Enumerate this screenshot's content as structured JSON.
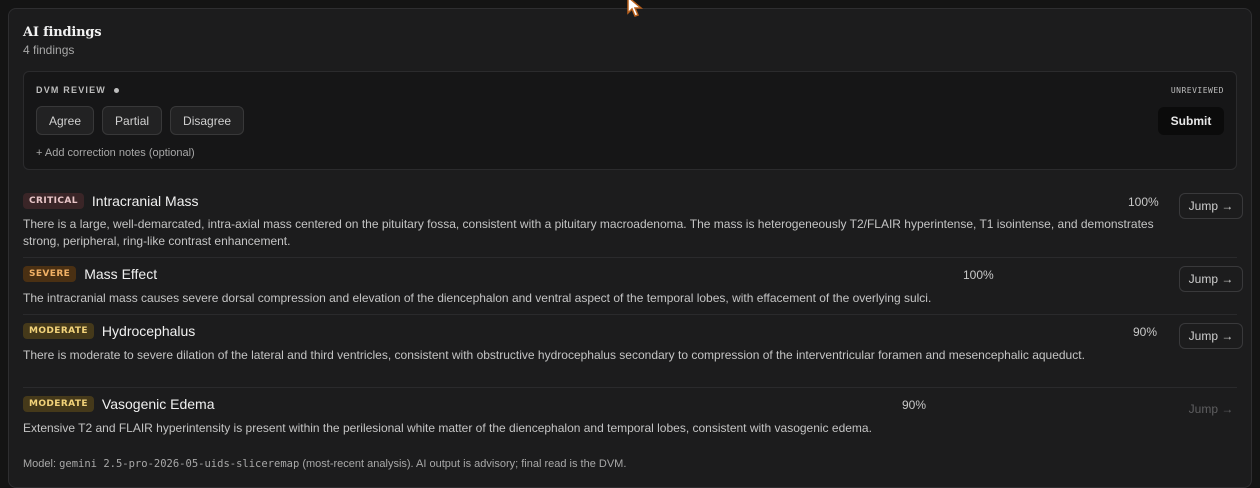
{
  "panel": {
    "title": "AI findings",
    "count_text": "4 findings"
  },
  "review": {
    "label": "DVM REVIEW",
    "status": "UNREVIEWED",
    "buttons": [
      "Agree",
      "Partial",
      "Disagree"
    ],
    "submit_label": "Submit",
    "notes_link": "+ Add correction notes (optional)"
  },
  "findings": [
    {
      "severity": "CRITICAL",
      "name": "Intracranial Mass",
      "confidence": "100%",
      "description": "There is a large, well-demarcated, intra-axial mass centered on the pituitary fossa, consistent with a pituitary macroadenoma. The mass is heterogeneously T2/FLAIR hyperintense, T1 isointense, and demonstrates strong, peripheral, ring-like contrast enhancement.",
      "jump_label": "Jump →",
      "jump_enabled": true
    },
    {
      "severity": "SEVERE",
      "name": "Mass Effect",
      "confidence": "100%",
      "description": "The intracranial mass causes severe dorsal compression and elevation of the diencephalon and ventral aspect of the temporal lobes, with effacement of the overlying sulci.",
      "jump_label": "Jump →",
      "jump_enabled": true
    },
    {
      "severity": "MODERATE",
      "name": "Hydrocephalus",
      "confidence": "90%",
      "description": "There is moderate to severe dilation of the lateral and third ventricles, consistent with obstructive hydrocephalus secondary to compression of the interventricular foramen and mesencephalic aqueduct.",
      "jump_label": "Jump →",
      "jump_enabled": true
    },
    {
      "severity": "MODERATE",
      "name": "Vasogenic Edema",
      "confidence": "90%",
      "description": "Extensive T2 and FLAIR hyperintensity is present within the perilesional white matter of the diencephalon and temporal lobes, consistent with vasogenic edema.",
      "jump_label": "Jump →",
      "jump_enabled": false
    }
  ],
  "footer": {
    "prefix": "Model: ",
    "model": "gemini 2.5-pro-2026-05-uids-sliceremap",
    "suffix": " (most-recent analysis). AI output is advisory; final read is the DVM."
  },
  "colors": {
    "critical": "#e9c6c8",
    "severe": "#f1b166",
    "moderate": "#f2d37a"
  }
}
